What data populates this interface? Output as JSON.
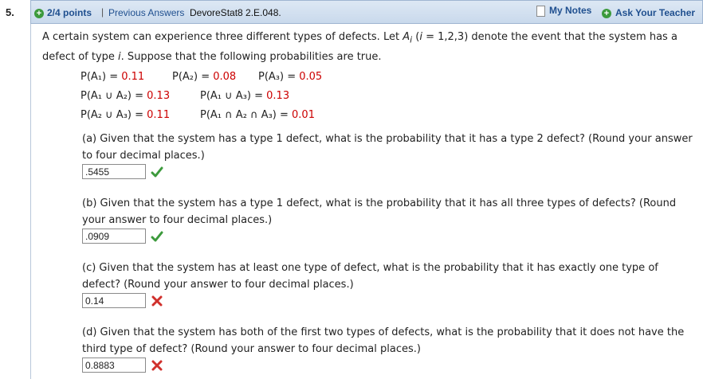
{
  "question_number": "5.",
  "header": {
    "points": "2/4 points",
    "separator": "|",
    "previous_answers": "Previous Answers",
    "problem_code": "DevoreStat8 2.E.048.",
    "my_notes": "My Notes",
    "ask_teacher": "Ask Your Teacher"
  },
  "intro": {
    "l1a": "A certain system can experience three different types of defects. Let ",
    "ai_a": "A",
    "ai_sub": "i",
    "l1b": " (",
    "i_var": "i",
    "l1c": " = 1,2,3) denote the event that the system has a defect of type ",
    "i_var2": "i",
    "l1d": ". Suppose that the following probabilities are true."
  },
  "probs": {
    "p1_label": "P(A₁) = ",
    "p1_val": "0.11",
    "p2_label": "P(A₂) = ",
    "p2_val": "0.08",
    "p3_label": "P(A₃) = ",
    "p3_val": "0.05",
    "p12_label": "P(A₁ ∪ A₂) = ",
    "p12_val": "0.13",
    "p13_label": "P(A₁ ∪ A₃) = ",
    "p13_val": "0.13",
    "p23_label": "P(A₂ ∪ A₃) = ",
    "p23_val": "0.11",
    "p123_label": "P(A₁ ∩ A₂ ∩ A₃) = ",
    "p123_val": "0.01"
  },
  "parts": [
    {
      "question": "(a) Given that the system has a type 1 defect, what is the probability that it has a type 2 defect? (Round your answer to four decimal places.)",
      "answer": ".5455",
      "status": "correct",
      "mark_icon": "checkmark-icon"
    },
    {
      "question": "(b) Given that the system has a type 1 defect, what is the probability that it has all three types of defects? (Round your answer to four decimal places.)",
      "answer": ".0909",
      "status": "correct",
      "mark_icon": "checkmark-icon"
    },
    {
      "question": "(c) Given that the system has at least one type of defect, what is the probability that it has exactly one type of defect? (Round your answer to four decimal places.)",
      "answer": "0.14",
      "status": "incorrect",
      "mark_icon": "x-mark-icon"
    },
    {
      "question": "(d) Given that the system has both of the first two types of defects, what is the probability that it does not have the third type of defect? (Round your answer to four decimal places.)",
      "answer": "0.8883",
      "status": "incorrect",
      "mark_icon": "x-mark-icon"
    }
  ],
  "colors": {
    "header_bg": "#c9d9ec",
    "link": "#1f4f8f",
    "value_red": "#cc0000",
    "correct_green": "#3c9a3c",
    "incorrect_red": "#d0302c"
  }
}
